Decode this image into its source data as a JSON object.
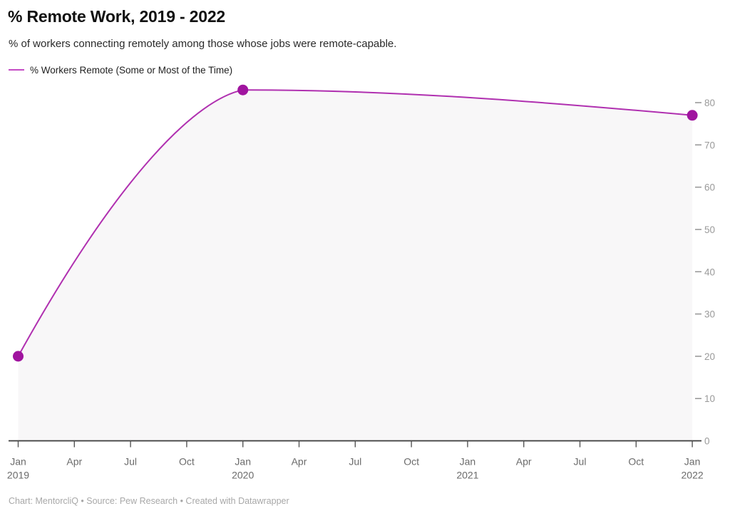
{
  "header": {
    "title": "% Remote Work, 2019 - 2022",
    "subtitle": "% of workers connecting remotely among those whose jobs were remote-capable."
  },
  "legend": {
    "items": [
      {
        "label": "% Workers Remote (Some or Most of the Time)",
        "color": "#c44cc4"
      }
    ]
  },
  "footer": {
    "text": "Chart: MentorcliQ • Source: Pew Research • Created with Datawrapper"
  },
  "colors": {
    "line": "#b030b0",
    "marker": "#a0149f",
    "legend_line": "#c44cc4",
    "area_fill": "#f8f7f8",
    "axis": "#3a3a3a",
    "tick_label": "#9a9a9a",
    "x_tick_label": "#6b6b6b",
    "footer_text": "#a8a8a8"
  },
  "chart_data": {
    "type": "line",
    "title": "% Remote Work, 2019 - 2022",
    "subtitle": "% of workers connecting remotely among those whose jobs were remote-capable.",
    "xlabel": "",
    "ylabel": "",
    "ylim": [
      0,
      85
    ],
    "yticks": [
      0,
      10,
      20,
      30,
      40,
      50,
      60,
      70,
      80
    ],
    "ytick_labels": [
      "0",
      "10",
      "20",
      "30",
      "40",
      "50",
      "60",
      "70",
      "80"
    ],
    "y_axis_position": "right",
    "grid": false,
    "area_filled": true,
    "legend_position": "top-left",
    "xticks": [
      {
        "month": "Jan",
        "year": "2019"
      },
      {
        "month": "Apr",
        "year": ""
      },
      {
        "month": "Jul",
        "year": ""
      },
      {
        "month": "Oct",
        "year": ""
      },
      {
        "month": "Jan",
        "year": "2020"
      },
      {
        "month": "Apr",
        "year": ""
      },
      {
        "month": "Jul",
        "year": ""
      },
      {
        "month": "Oct",
        "year": ""
      },
      {
        "month": "Jan",
        "year": "2021"
      },
      {
        "month": "Apr",
        "year": ""
      },
      {
        "month": "Jul",
        "year": ""
      },
      {
        "month": "Oct",
        "year": ""
      },
      {
        "month": "Jan",
        "year": "2022"
      }
    ],
    "series": [
      {
        "name": "% Workers Remote (Some or Most of the Time)",
        "color": "#b030b0",
        "markers": [
          {
            "x": "Jan 2019",
            "y": 20
          },
          {
            "x": "Jan 2020",
            "y": 83
          },
          {
            "x": "Jan 2022",
            "y": 77
          }
        ],
        "x": [
          "Jan 2019",
          "Jan 2020",
          "Jan 2022"
        ],
        "values": [
          20,
          83,
          77
        ]
      }
    ]
  }
}
